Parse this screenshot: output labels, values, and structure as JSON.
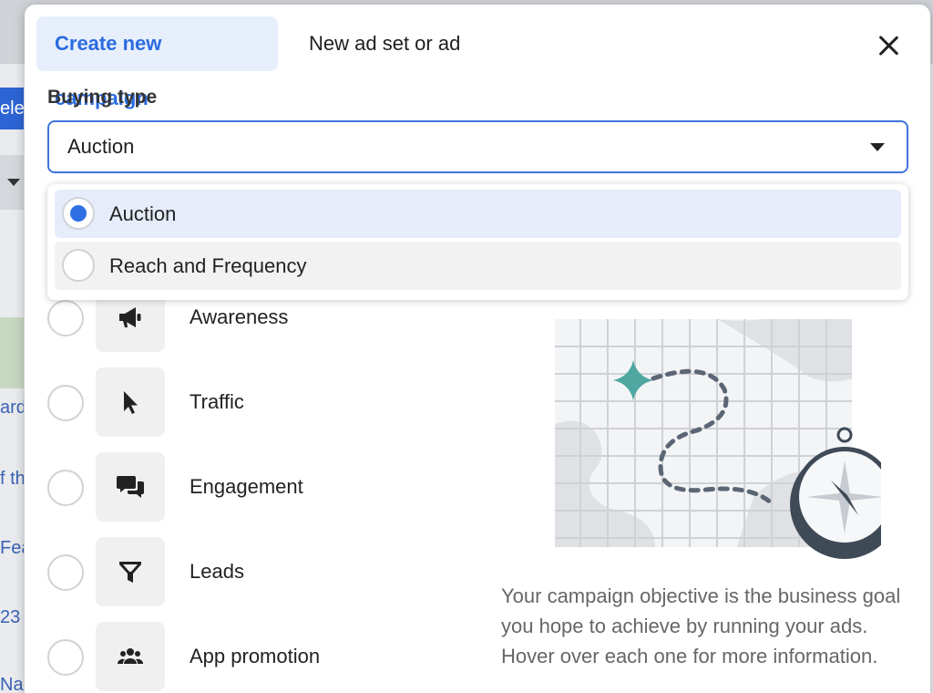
{
  "background": {
    "button_fragment": "ele",
    "text_fragments": [
      "ard",
      "f th",
      "Fea",
      "23",
      "Nac"
    ]
  },
  "tabs": [
    {
      "label": "Create new campaign",
      "active": true
    },
    {
      "label": "New ad set or ad",
      "active": false
    }
  ],
  "buying_type": {
    "label": "Buying type",
    "selected_value": "Auction",
    "options": [
      {
        "label": "Auction",
        "selected": true
      },
      {
        "label": "Reach and Frequency",
        "selected": false
      }
    ]
  },
  "objectives": [
    {
      "label": "Awareness",
      "icon": "megaphone-icon"
    },
    {
      "label": "Traffic",
      "icon": "cursor-icon"
    },
    {
      "label": "Engagement",
      "icon": "chat-bubbles-icon"
    },
    {
      "label": "Leads",
      "icon": "funnel-icon"
    },
    {
      "label": "App promotion",
      "icon": "people-icon"
    }
  ],
  "description": "Your campaign objective is the business goal you hope to achieve by running your ads. Hover over each one for more information.",
  "colors": {
    "accent": "#2a6be0",
    "tab_active_bg": "#e7effc",
    "map_teal": "#4fa7a2"
  }
}
